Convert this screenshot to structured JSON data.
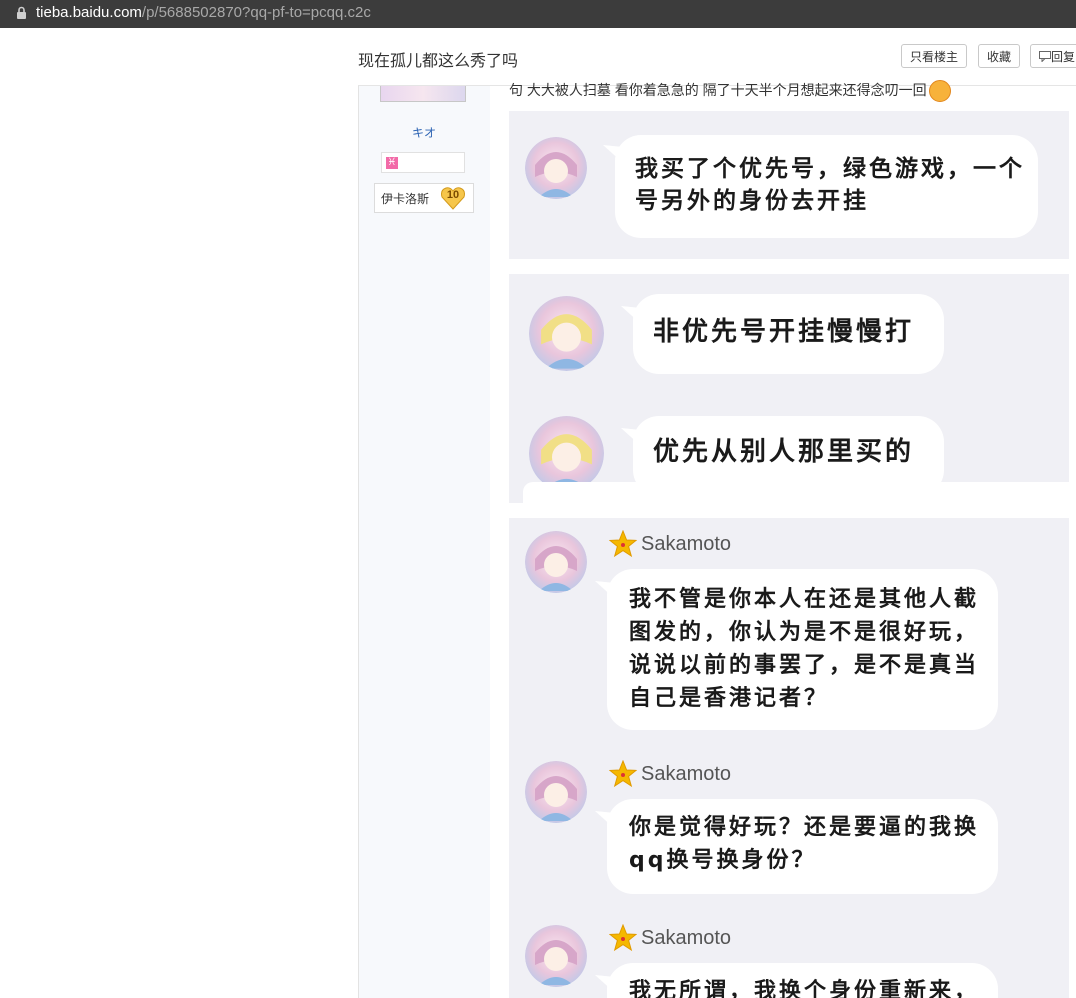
{
  "browser": {
    "url_host": "tieba.baidu.com",
    "url_path": "/p/5688502870?qq-pf-to=pcqq.c2c"
  },
  "thread": {
    "title": "现在孤儿都这么秀了吗",
    "buttons": {
      "only_op": "只看楼主",
      "favorite": "收藏",
      "reply": "回复"
    }
  },
  "author": {
    "username": "キオ",
    "zodiac_symbol": "♓",
    "forum_level_name": "伊卡洛斯",
    "forum_level": "10"
  },
  "post": {
    "text": "句 大大被人扫墓 看你着急急的 隔了十天半个月想起来还得念叨一回"
  },
  "screenshots": [
    {
      "messages": [
        {
          "lines": [
            "我买了个优先号，绿色游戏，一个",
            "号另外的身份去开挂"
          ]
        }
      ]
    },
    {
      "messages": [
        {
          "lines": [
            "非优先号开挂慢慢打"
          ]
        },
        {
          "lines": [
            "优先从别人那里买的"
          ]
        }
      ]
    },
    {
      "messages": [
        {
          "sender": "Sakamoto",
          "lines": [
            "我不管是你本人在还是其他人截",
            "图发的，你认为是不是很好玩，",
            "说说以前的事罢了，是不是真当",
            "自己是香港记者？"
          ]
        },
        {
          "sender": "Sakamoto",
          "lines": [
            "你是觉得好玩？还是要逼的我换",
            "qq换号换身份？"
          ]
        },
        {
          "sender": "Sakamoto",
          "lines": [
            "我无所谓，我换个身份重新来，"
          ]
        }
      ]
    }
  ],
  "colors": {
    "link": "#2d64b3",
    "panel_bg": "#f0f0f5",
    "star": "#f5b800",
    "urlbar": "#3c3c3c"
  },
  "icons": [
    "lock-icon",
    "reply-icon",
    "zodiac-icon",
    "level-badge-icon",
    "emoji-icon",
    "star-icon"
  ]
}
